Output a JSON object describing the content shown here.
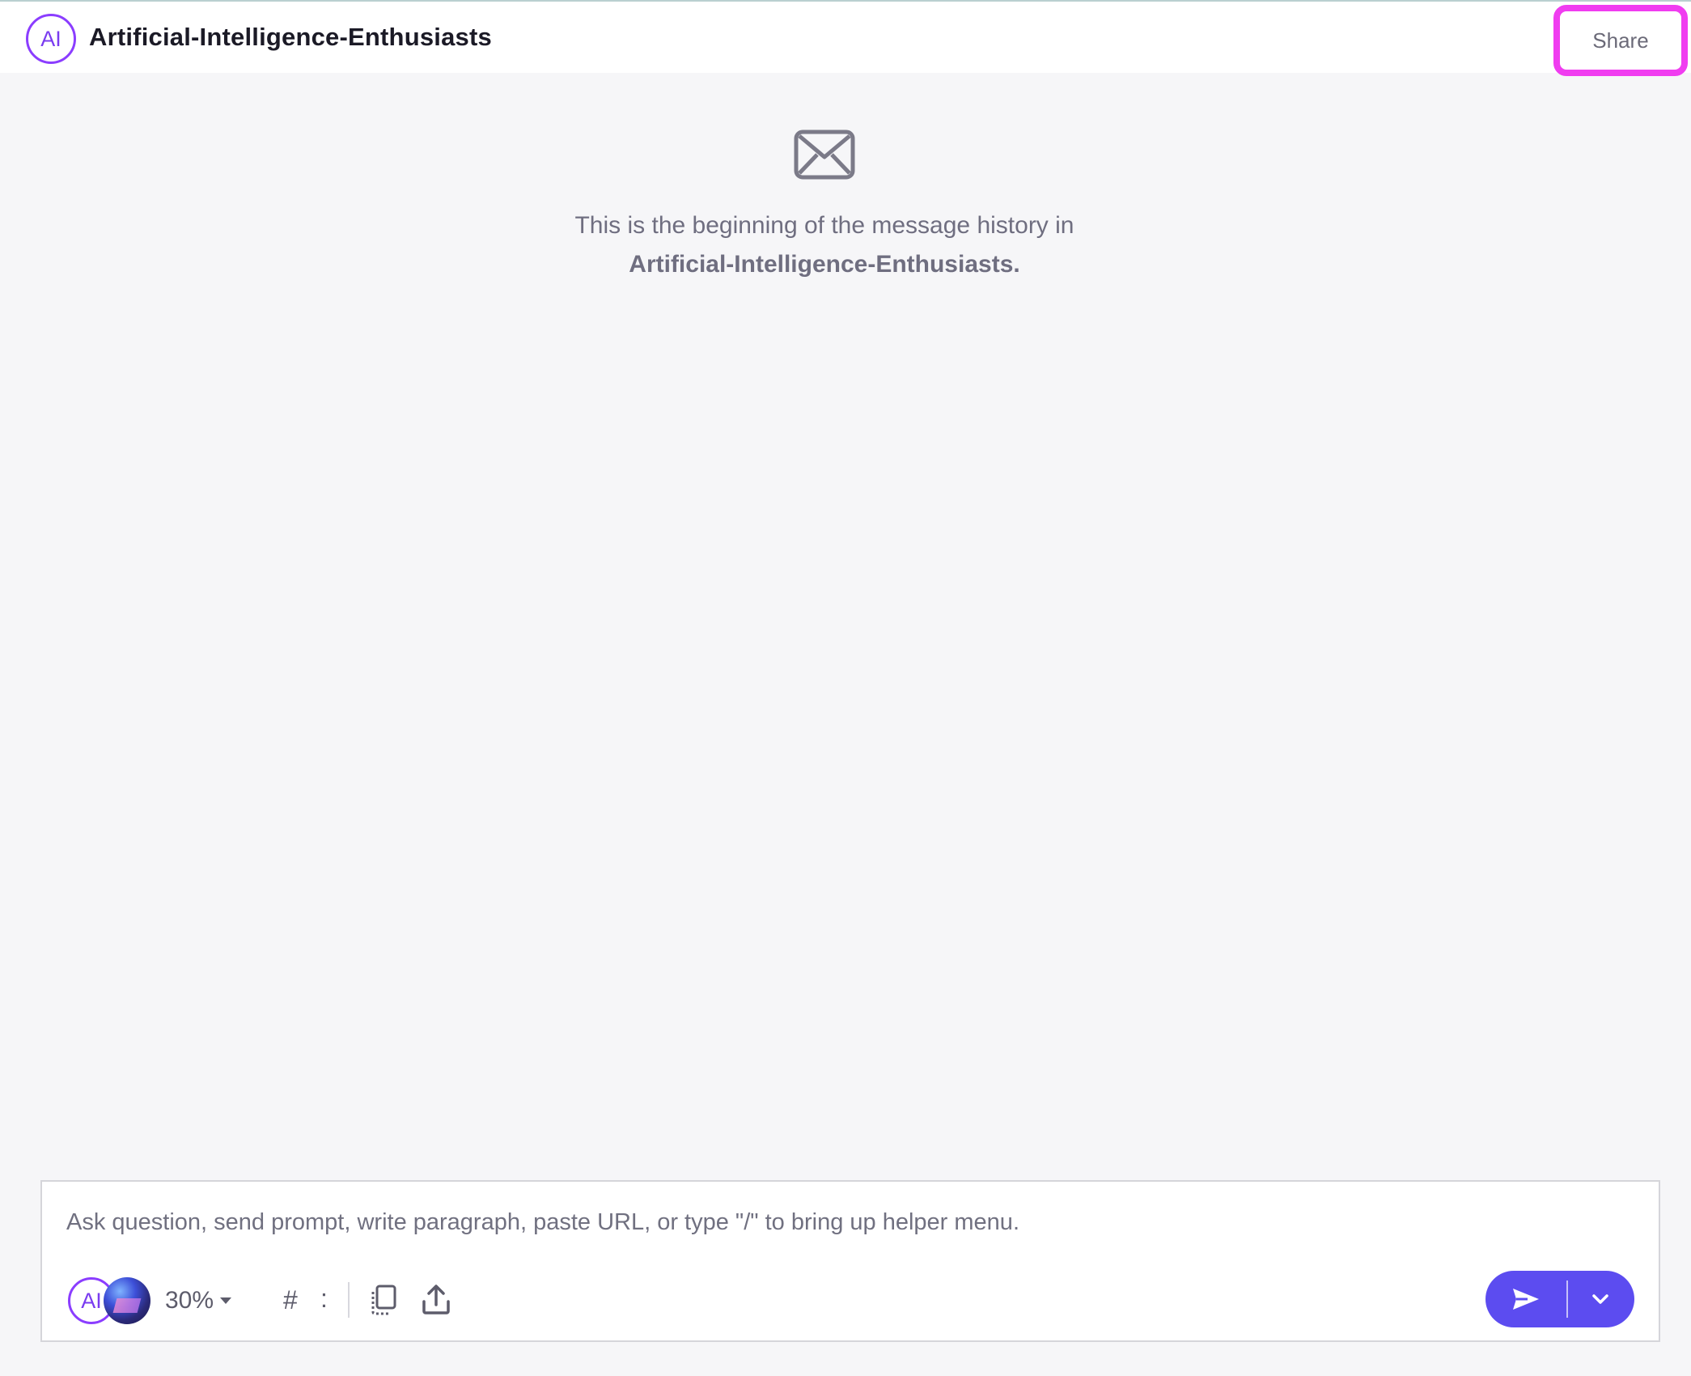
{
  "header": {
    "avatar_text": "AI",
    "channel_title": "Artificial-Intelligence-Enthusiasts",
    "share_label": "Share"
  },
  "empty_state": {
    "icon": "mail-icon",
    "line1": "This is the beginning of the message history in",
    "line2": "Artificial-Intelligence-Enthusiasts."
  },
  "composer": {
    "placeholder": "Ask question, send prompt, write paragraph, paste URL, or type \"/\" to bring up helper menu.",
    "value": "",
    "toolbar": {
      "ai_avatar_text": "AI",
      "percent_label": "30%",
      "hash_label": "#",
      "colon_label": ":",
      "icons": [
        "copy-icon",
        "upload-icon"
      ]
    },
    "send_icon": "send-icon",
    "more_icon": "chevron-down-icon"
  },
  "colors": {
    "accent": "#5c4cf0",
    "avatar_border": "#8b3dff",
    "highlight": "#f03cf0"
  }
}
